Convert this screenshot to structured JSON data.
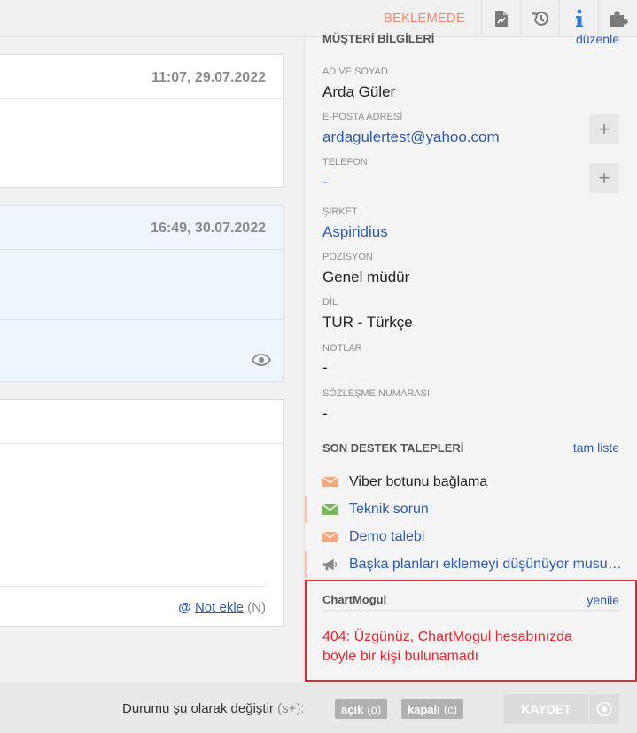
{
  "topbar": {
    "status": "BEKLEMEDE",
    "icons": [
      "document-chart-icon",
      "history-icon",
      "info-icon",
      "puzzle-icon"
    ]
  },
  "timeline": {
    "card1_time": "11:07, 29.07.2022",
    "card2_time": "16:49, 30.07.2022",
    "note_at": "@",
    "note_link": "Not ekle",
    "note_shortcut": "(N)"
  },
  "customer": {
    "section_title": "MÜŞTERİ BİLGİLERİ",
    "edit_link": "düzenle",
    "name_label": "AD VE SOYAD",
    "name": "Arda Güler",
    "email_label": "E-POSTA ADRESİ",
    "email": "ardagulertest@yahoo.com",
    "phone_label": "TELEFON",
    "phone": "-",
    "company_label": "ŞİRKET",
    "company": "Aspiridius",
    "position_label": "POZİSYON",
    "position": "Genel müdür",
    "language_label": "DİL",
    "language": "TUR - Türkçe",
    "notes_label": "NOTLAR",
    "notes": "-",
    "contract_label": "SÖZLEŞME NUMARASI",
    "contract": "-"
  },
  "recent": {
    "title": "SON DESTEK TALEPLERİ",
    "link": "tam liste",
    "tickets": [
      {
        "label": "Viber botunu bağlama",
        "icon": "envelope-icon",
        "color": "#f2a97e"
      },
      {
        "label": "Teknik sorun",
        "icon": "envelope-icon",
        "color": "#7ab85a"
      },
      {
        "label": "Demo talebi",
        "icon": "envelope-icon",
        "color": "#f2a97e"
      },
      {
        "label": "Başka planları eklemeyi düşünüyor musunuz?",
        "icon": "megaphone-icon",
        "color": "#888888"
      }
    ]
  },
  "chartmogul": {
    "title": "ChartMogul",
    "refresh": "yenile",
    "error": "404: Üzgünüz, ChartMogul hesabınızda böyle bir kişi bulunamadı"
  },
  "bottombar": {
    "label": "Durumu şu olarak değiştir",
    "shortcut": "(s+):",
    "open_label": "açık",
    "open_key": "(o)",
    "closed_label": "kapalı",
    "closed_key": "(c)",
    "save": "KAYDET"
  },
  "colors": {
    "status": "#f08a6a",
    "link": "#2a5caa",
    "error": "#e0282e"
  }
}
